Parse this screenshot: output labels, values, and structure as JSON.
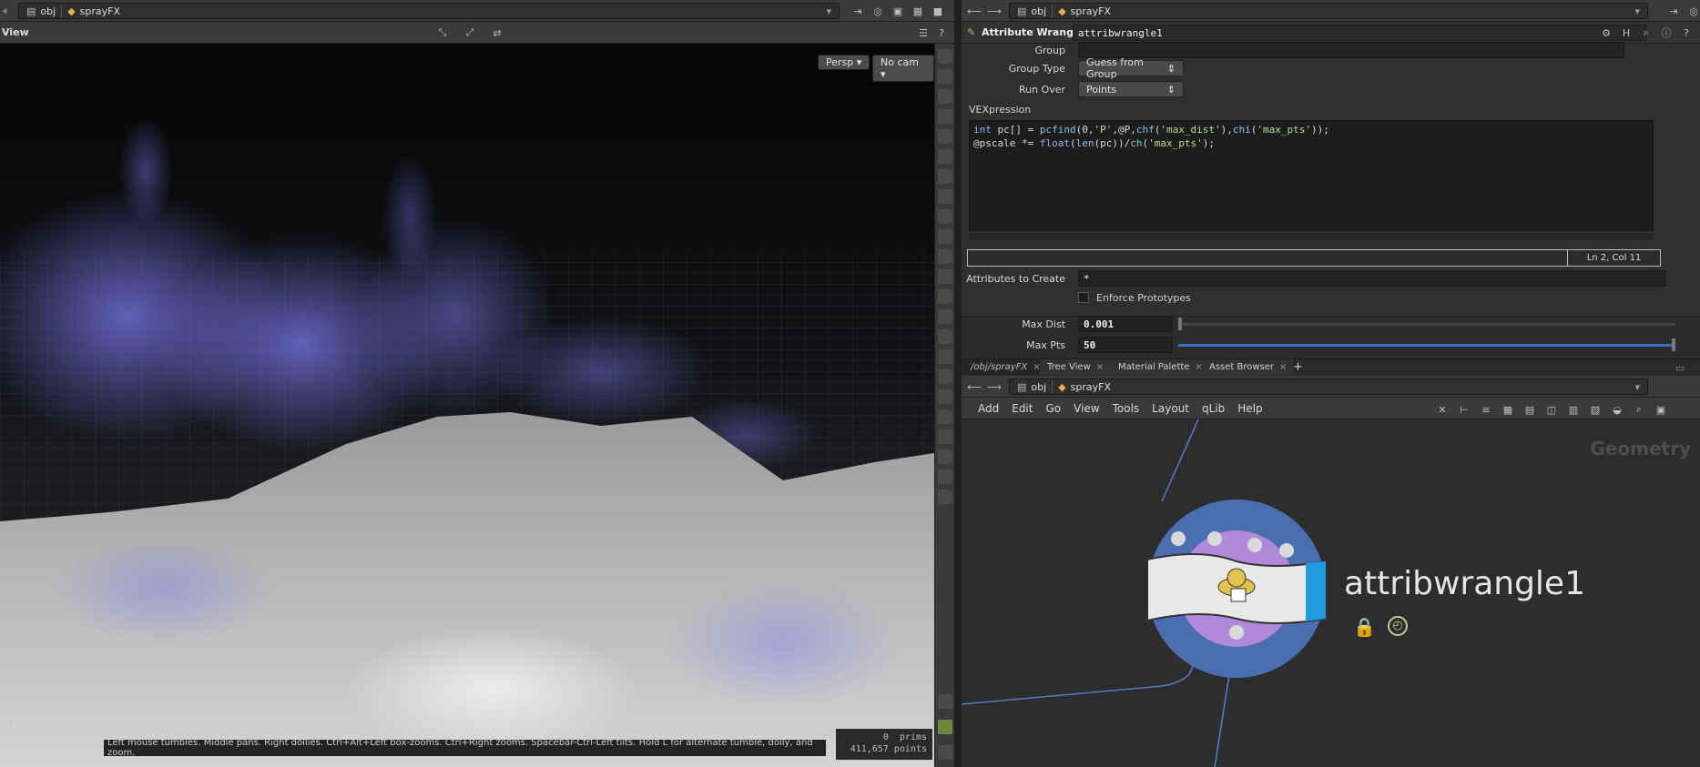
{
  "left_pane": {
    "path": {
      "root": "obj",
      "node": "sprayFX"
    },
    "view_label": "View",
    "persp_button": "Persp ▾",
    "cam_button": "No cam ▾",
    "status_hint": "Left mouse tumbles. Middle pans. Right dollies. Ctrl+Alt+Left box-zooms. Ctrl+Right zooms. Spacebar-Ctrl-Left tilts. Hold L for alternate tumble, dolly, and zoom.",
    "counts": {
      "prims_value": "0",
      "prims_label": "prims",
      "points_value": "411,657",
      "points_label": "points"
    }
  },
  "right_pane": {
    "path": {
      "root": "obj",
      "node": "sprayFX"
    },
    "node_type": "Attribute Wrangle",
    "node_name": "attribwrangle1",
    "params": {
      "group_label": "Group",
      "group_value": "",
      "group_type_label": "Group Type",
      "group_type_value": "Guess from Group",
      "run_over_label": "Run Over",
      "run_over_value": "Points",
      "vex_label": "VEXpression",
      "vex_line1": {
        "a": "int",
        "b": " pc[] = ",
        "c": "pcfind",
        "d": "(0,",
        "e": "'P'",
        "f": ",@P,",
        "g": "chf",
        "h": "(",
        "i": "'max_dist'",
        "j": "),",
        "k": "chi",
        "l": "(",
        "m": "'max_pts'",
        "n": "));"
      },
      "vex_line2": {
        "a": "@pscale *= ",
        "b": "float",
        "c": "(",
        "d": "len",
        "e": "(pc))/",
        "f": "ch",
        "g": "(",
        "h": "'max_pts'",
        "i": ");"
      },
      "cursor_pos": "Ln 2, Col 11",
      "attrs_label": "Attributes to Create",
      "attrs_value": "*",
      "enforce_label": "Enforce Prototypes",
      "max_dist_label": "Max Dist",
      "max_dist_value": "0.001",
      "max_pts_label": "Max Pts",
      "max_pts_value": "50"
    },
    "tabs": [
      {
        "label": "/obj/sprayFX"
      },
      {
        "label": "Tree View"
      },
      {
        "label": "Material Palette"
      },
      {
        "label": "Asset Browser"
      }
    ],
    "network_path": {
      "root": "obj",
      "node": "sprayFX"
    },
    "menu": [
      "Add",
      "Edit",
      "Go",
      "View",
      "Tools",
      "Layout",
      "qLib",
      "Help"
    ],
    "network_context": "Geometry",
    "node_label": "attribwrangle1"
  },
  "colors": {
    "particles": "#7070e8",
    "node_outer": "#4a6fb0",
    "node_inner": "#b08ad8",
    "node_accent": "#1e9be0"
  }
}
